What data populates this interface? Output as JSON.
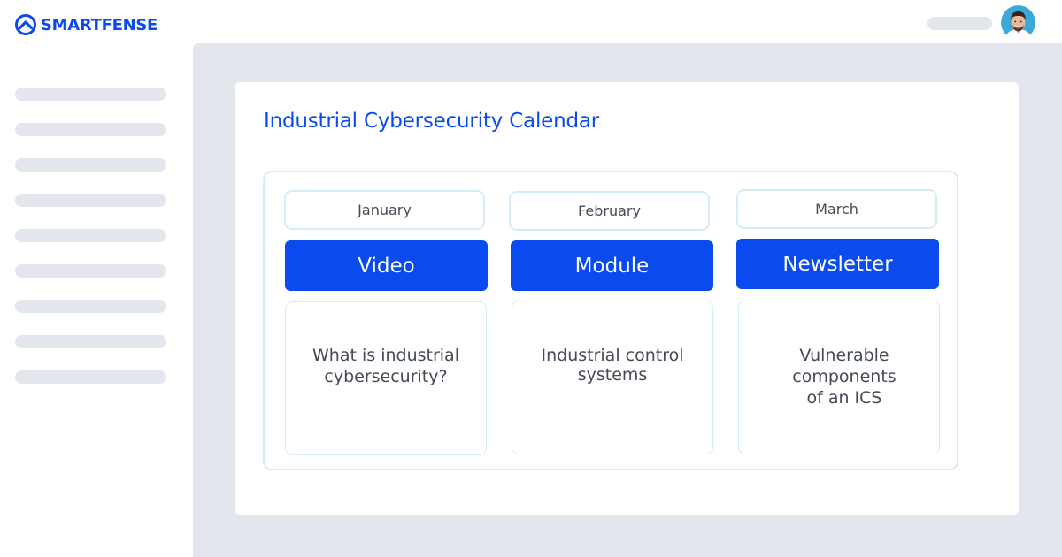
{
  "brand": {
    "name": "SMARTFENSE",
    "color": "#0a4bf0"
  },
  "header": {
    "avatar_icon": "user-avatar"
  },
  "calendar": {
    "title": "Industrial Cybersecurity Calendar",
    "months": [
      {
        "month": "January",
        "type": "Video",
        "description_lines": [
          "What is industrial",
          "cybersecurity?"
        ]
      },
      {
        "month": "February",
        "type": "Module",
        "description_lines": [
          "Industrial control",
          "systems"
        ]
      },
      {
        "month": "March",
        "type": "Newsletter",
        "description_lines": [
          "Vulnerable",
          "components",
          "of an ICS"
        ]
      }
    ]
  }
}
